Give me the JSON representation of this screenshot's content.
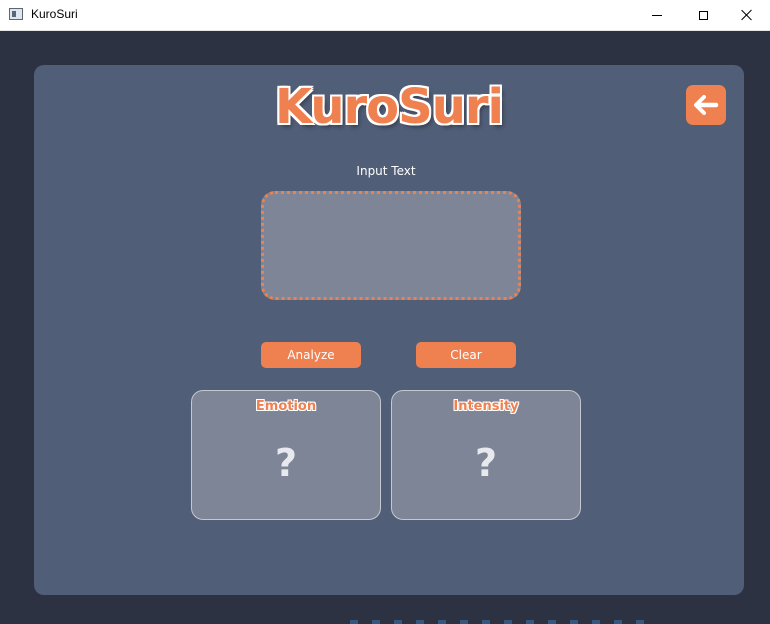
{
  "window": {
    "title": "KuroSuri",
    "controls": {
      "minimize": "minimize-icon",
      "maximize": "maximize-icon",
      "close": "close-icon"
    }
  },
  "app": {
    "logo": "KuroSuri",
    "back_icon": "arrow-left-icon"
  },
  "input": {
    "label": "Input Text",
    "value": "",
    "placeholder": ""
  },
  "buttons": {
    "analyze": "Analyze",
    "clear": "Clear"
  },
  "results": {
    "emotion": {
      "title": "Emotion",
      "value": "?"
    },
    "intensity": {
      "title": "Intensity",
      "value": "?"
    }
  },
  "colors": {
    "accent": "#ef8150",
    "card": "#515e77",
    "background": "#2d3243",
    "field": "#7e8596"
  }
}
